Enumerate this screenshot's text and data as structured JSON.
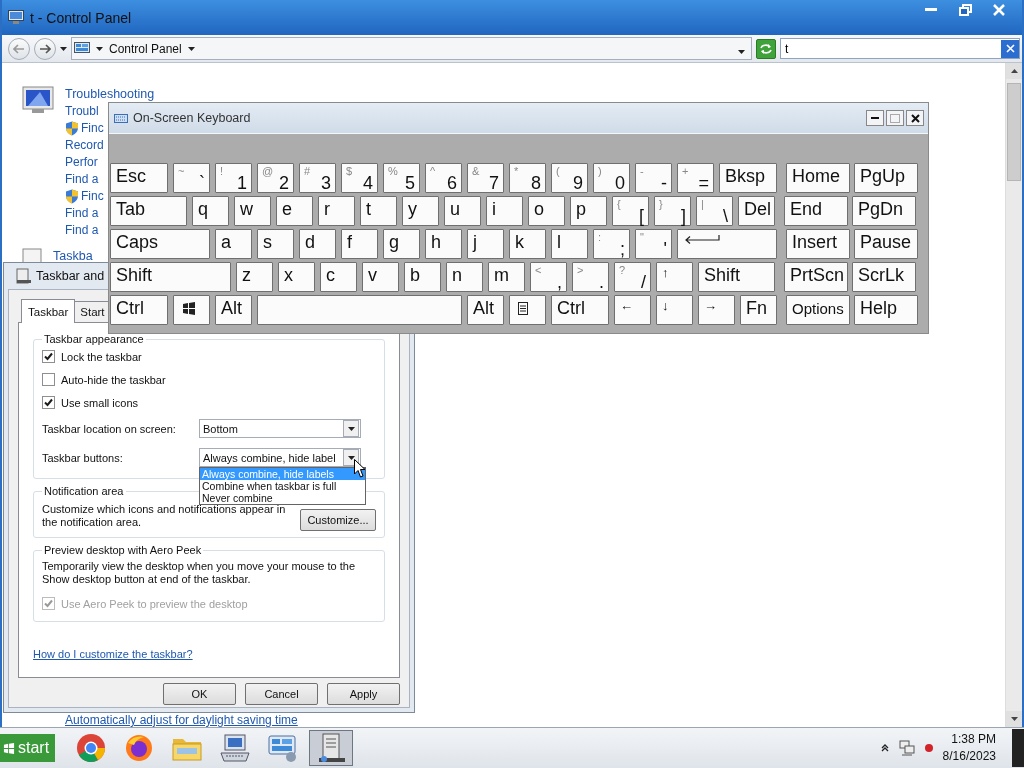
{
  "control_panel": {
    "title": "t - Control Panel",
    "address": "Control Panel",
    "search": "t",
    "groups": [
      {
        "kind": "troubleshooting",
        "links": [
          {
            "text": "Troubleshooting",
            "kind": "heading"
          },
          {
            "text": "Troubl",
            "kind": "link"
          },
          {
            "text": "Finc",
            "kind": "shield"
          },
          {
            "text": "Record",
            "kind": "link"
          },
          {
            "text": "Perfor",
            "kind": "link"
          },
          {
            "text": "Find a",
            "kind": "link"
          },
          {
            "text": "Finc",
            "kind": "shield"
          },
          {
            "text": "Find a",
            "kind": "link"
          },
          {
            "text": "Find a",
            "kind": "link"
          }
        ]
      },
      {
        "kind": "taskbar",
        "links": [
          {
            "text": "Taskba",
            "kind": "heading"
          }
        ]
      }
    ],
    "footer_link": "Automatically adjust for daylight saving time"
  },
  "taskbar_dialog": {
    "title": "Taskbar and",
    "tabs": [
      {
        "label": "Taskbar",
        "selected": true
      },
      {
        "label": "Start",
        "selected": false
      }
    ],
    "appearance": {
      "legend": "Taskbar appearance",
      "options": [
        {
          "label": "Lock the taskbar",
          "checked": true
        },
        {
          "label": "Auto-hide the taskbar",
          "checked": false
        },
        {
          "label": "Use small icons",
          "checked": true
        }
      ],
      "location": {
        "label": "Taskbar location on screen:",
        "value": "Bottom"
      },
      "buttons": {
        "label": "Taskbar buttons:",
        "value": "Always combine, hide label",
        "expanded": true,
        "options": [
          {
            "label": "Always combine, hide labels",
            "selected": true
          },
          {
            "label": "Combine when taskbar is full",
            "selected": false
          },
          {
            "label": "Never combine",
            "selected": false
          }
        ]
      }
    },
    "notification": {
      "legend": "Notification area",
      "text": "Customize which icons and notifications appear in the notification area.",
      "button": "Customize..."
    },
    "aero_peek": {
      "legend": "Preview desktop with Aero Peek",
      "text": "Temporarily view the desktop when you move your mouse to the Show desktop button at end of the taskbar.",
      "option": {
        "label": "Use Aero Peek to preview the desktop",
        "checked": true,
        "disabled": true
      }
    },
    "help_link": "How do I customize the taskbar?",
    "actions": [
      "OK",
      "Cancel",
      "Apply"
    ]
  },
  "keyboard": {
    "title": "On-Screen Keyboard",
    "rows": [
      {
        "main": [
          {
            "label": "Esc",
            "kind": "wide"
          },
          {
            "shift": "~",
            "label": "`",
            "kind": "char"
          },
          {
            "shift": "!",
            "label": "1",
            "kind": "char"
          },
          {
            "shift": "@",
            "label": "2",
            "kind": "char"
          },
          {
            "shift": "#",
            "label": "3",
            "kind": "char"
          },
          {
            "shift": "$",
            "label": "4",
            "kind": "char"
          },
          {
            "shift": "%",
            "label": "5",
            "kind": "char"
          },
          {
            "shift": "^",
            "label": "6",
            "kind": "char"
          },
          {
            "shift": "&",
            "label": "7",
            "kind": "char"
          },
          {
            "shift": "*",
            "label": "8",
            "kind": "char"
          },
          {
            "shift": "(",
            "label": "9",
            "kind": "char"
          },
          {
            "shift": ")",
            "label": "0",
            "kind": "char"
          },
          {
            "shift": "-",
            "label": "-",
            "kind": "char"
          },
          {
            "shift": "+",
            "label": "=",
            "kind": "char"
          },
          {
            "label": "Bksp",
            "kind": "wide"
          }
        ],
        "nav": [
          {
            "label": "Home",
            "kind": "nav"
          },
          {
            "label": "PgUp",
            "kind": "nav"
          }
        ]
      },
      {
        "main": [
          {
            "label": "Tab",
            "kind": "tab"
          },
          {
            "label": "q",
            "kind": "std"
          },
          {
            "label": "w",
            "kind": "std"
          },
          {
            "label": "e",
            "kind": "std"
          },
          {
            "label": "r",
            "kind": "std"
          },
          {
            "label": "t",
            "kind": "std"
          },
          {
            "label": "y",
            "kind": "std"
          },
          {
            "label": "u",
            "kind": "std"
          },
          {
            "label": "i",
            "kind": "std"
          },
          {
            "label": "o",
            "kind": "std"
          },
          {
            "label": "p",
            "kind": "std"
          },
          {
            "shift": "{",
            "label": "[",
            "kind": "char"
          },
          {
            "shift": "}",
            "label": "]",
            "kind": "char"
          },
          {
            "shift": "|",
            "label": "\\",
            "kind": "char"
          },
          {
            "label": "Del",
            "kind": "std"
          }
        ],
        "nav": [
          {
            "label": "End",
            "kind": "nav"
          },
          {
            "label": "PgDn",
            "kind": "nav"
          }
        ]
      },
      {
        "main": [
          {
            "label": "Caps",
            "kind": "caps"
          },
          {
            "label": "a",
            "kind": "std"
          },
          {
            "label": "s",
            "kind": "std"
          },
          {
            "label": "d",
            "kind": "std"
          },
          {
            "label": "f",
            "kind": "std"
          },
          {
            "label": "g",
            "kind": "std"
          },
          {
            "label": "h",
            "kind": "std"
          },
          {
            "label": "j",
            "kind": "std"
          },
          {
            "label": "k",
            "kind": "std"
          },
          {
            "label": "l",
            "kind": "std"
          },
          {
            "shift": ":",
            "label": ";",
            "kind": "char"
          },
          {
            "shift": "\"",
            "label": "'",
            "kind": "char"
          },
          {
            "kind": "enter"
          }
        ],
        "nav": [
          {
            "label": "Insert",
            "kind": "nav"
          },
          {
            "label": "Pause",
            "kind": "nav"
          }
        ]
      },
      {
        "main": [
          {
            "label": "Shift",
            "kind": "shift"
          },
          {
            "label": "z",
            "kind": "std"
          },
          {
            "label": "x",
            "kind": "std"
          },
          {
            "label": "c",
            "kind": "std"
          },
          {
            "label": "v",
            "kind": "std"
          },
          {
            "label": "b",
            "kind": "std"
          },
          {
            "label": "n",
            "kind": "std"
          },
          {
            "label": "m",
            "kind": "std"
          },
          {
            "shift": "<",
            "label": ",",
            "kind": "char"
          },
          {
            "shift": ">",
            "label": ".",
            "kind": "char"
          },
          {
            "shift": "?",
            "label": "/",
            "kind": "char"
          },
          {
            "label": "↑",
            "kind": "arrow"
          },
          {
            "label": "Shift",
            "kind": "tab"
          }
        ],
        "nav": [
          {
            "label": "PrtScn",
            "kind": "nav"
          },
          {
            "label": "ScrLk",
            "kind": "nav"
          }
        ]
      },
      {
        "main": [
          {
            "label": "Ctrl",
            "kind": "wide"
          },
          {
            "kind": "win"
          },
          {
            "label": "Alt",
            "kind": "std"
          },
          {
            "kind": "space"
          },
          {
            "label": "Alt",
            "kind": "std"
          },
          {
            "kind": "menu"
          },
          {
            "label": "Ctrl",
            "kind": "wide"
          },
          {
            "label": "←",
            "kind": "arrow"
          },
          {
            "label": "↓",
            "kind": "arrow"
          },
          {
            "label": "→",
            "kind": "arrow"
          },
          {
            "label": "Fn",
            "kind": "std"
          }
        ],
        "nav": [
          {
            "label": "Options",
            "kind": "navsmall"
          },
          {
            "label": "Help",
            "kind": "nav"
          }
        ]
      }
    ]
  },
  "taskbar": {
    "start": "start",
    "apps": [
      {
        "kind": "chrome",
        "selected": false
      },
      {
        "kind": "firefox",
        "selected": false
      },
      {
        "kind": "explorer",
        "selected": false
      },
      {
        "kind": "keyboard",
        "selected": false
      },
      {
        "kind": "control",
        "selected": false
      },
      {
        "kind": "server",
        "selected": true
      }
    ],
    "time": "1:38 PM",
    "date": "8/16/2023"
  }
}
